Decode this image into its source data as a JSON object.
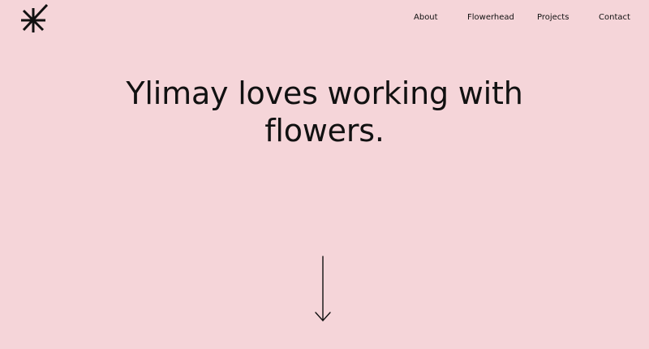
{
  "brand": {
    "logo_icon": "asterisk-logo-icon"
  },
  "nav": {
    "items": [
      {
        "label": "About"
      },
      {
        "label": "Flowerhead"
      },
      {
        "label": "Projects"
      },
      {
        "label": "Contact"
      }
    ]
  },
  "hero": {
    "heading_line1": "Ylimay loves working with",
    "heading_line2": "flowers."
  },
  "scroll": {
    "icon": "arrow-down-icon"
  },
  "colors": {
    "background": "#f5d5d9",
    "text": "#111111"
  }
}
